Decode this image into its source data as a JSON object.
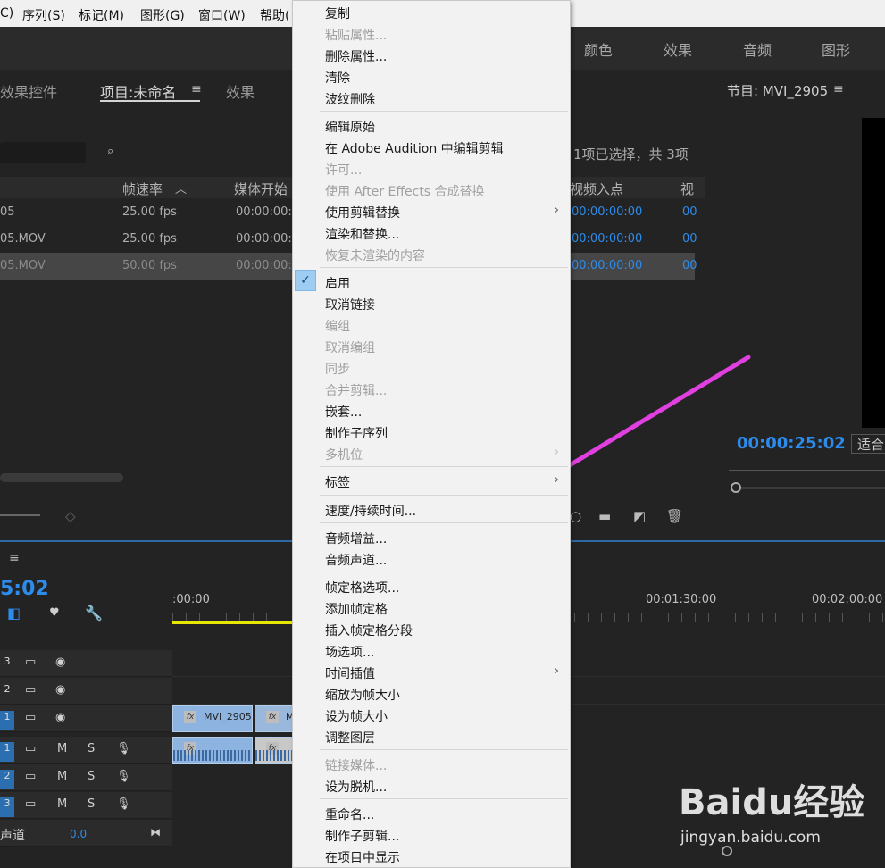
{
  "menubar": [
    "C)",
    "序列(S)",
    "标记(M)",
    "图形(G)",
    "窗口(W)",
    "帮助("
  ],
  "workspaces": [
    "颜色",
    "效果",
    "音频",
    "图形"
  ],
  "project_panel": {
    "tabs": [
      "效果控件",
      "项目:未命名",
      "效果"
    ],
    "selection_info": "1项已选择，共 3项",
    "columns": [
      "帧速率",
      "媒体开始",
      "视频入点",
      "视"
    ],
    "rows": [
      {
        "name": "05",
        "fps": "25.00 fps",
        "start": "00:00:00:0",
        "in": "00:00:00:00",
        "x": "00"
      },
      {
        "name": "05.MOV",
        "fps": "25.00 fps",
        "start": "00:00:00:0",
        "in": "00:00:00:00",
        "x": "00"
      },
      {
        "name": "05.MOV",
        "fps": "50.00 fps",
        "start": "00:00:00:0",
        "in": "00:00:00:00",
        "x": "00"
      }
    ]
  },
  "program_panel": {
    "title": "节目: MVI_2905",
    "timecode": "00:00:25:02",
    "fit": "适合"
  },
  "timeline": {
    "timecode": "5:02",
    "ruler": [
      ":00:00",
      "00:01:30:00",
      "00:02:00:00"
    ],
    "tracks_video": [
      "3",
      "2",
      "1"
    ],
    "tracks_audio": [
      "1",
      "2",
      "3"
    ],
    "clip_v1": "MVI_2905.",
    "clip_v2": "M",
    "mix_label": "声道",
    "mix_value": "0.0",
    "track_m": "M",
    "track_s": "S"
  },
  "context_menu": {
    "items": [
      {
        "label": "复制",
        "enabled": true
      },
      {
        "label": "粘贴属性...",
        "enabled": false
      },
      {
        "label": "删除属性...",
        "enabled": true
      },
      {
        "label": "清除",
        "enabled": true
      },
      {
        "label": "波纹删除",
        "enabled": true
      },
      {
        "label": "编辑原始",
        "enabled": true
      },
      {
        "label": "在 Adobe Audition 中编辑剪辑",
        "enabled": true
      },
      {
        "label": "许可...",
        "enabled": false
      },
      {
        "label": "使用 After Effects 合成替换",
        "enabled": false
      },
      {
        "label": "使用剪辑替换",
        "enabled": true
      },
      {
        "label": "渲染和替换...",
        "enabled": true
      },
      {
        "label": "恢复未渲染的内容",
        "enabled": false
      },
      {
        "label": "启用",
        "enabled": true
      },
      {
        "label": "取消链接",
        "enabled": true
      },
      {
        "label": "编组",
        "enabled": false
      },
      {
        "label": "取消编组",
        "enabled": false
      },
      {
        "label": "同步",
        "enabled": false
      },
      {
        "label": "合并剪辑...",
        "enabled": false
      },
      {
        "label": "嵌套...",
        "enabled": true
      },
      {
        "label": "制作子序列",
        "enabled": true
      },
      {
        "label": "多机位",
        "enabled": false
      },
      {
        "label": "标签",
        "enabled": true
      },
      {
        "label": "速度/持续时间...",
        "enabled": true
      },
      {
        "label": "音频增益...",
        "enabled": true
      },
      {
        "label": "音频声道...",
        "enabled": true
      },
      {
        "label": "帧定格选项...",
        "enabled": true
      },
      {
        "label": "添加帧定格",
        "enabled": true
      },
      {
        "label": "插入帧定格分段",
        "enabled": true
      },
      {
        "label": "场选项...",
        "enabled": true
      },
      {
        "label": "时间插值",
        "enabled": true
      },
      {
        "label": "缩放为帧大小",
        "enabled": true
      },
      {
        "label": "设为帧大小",
        "enabled": true
      },
      {
        "label": "调整图层",
        "enabled": true
      },
      {
        "label": "链接媒体...",
        "enabled": false
      },
      {
        "label": "设为脱机...",
        "enabled": true
      },
      {
        "label": "重命名...",
        "enabled": true
      },
      {
        "label": "制作子剪辑...",
        "enabled": true
      },
      {
        "label": "在项目中显示",
        "enabled": true
      }
    ],
    "check_glyph": "✓",
    "submenu_glyph": "›"
  },
  "watermark": {
    "brand": "Baidu经验",
    "url": "jingyan.baidu.com"
  },
  "colors": {
    "accent": "#2d8ceb",
    "arrow": "#e040e0",
    "menu_bg": "#f2f2f2"
  }
}
